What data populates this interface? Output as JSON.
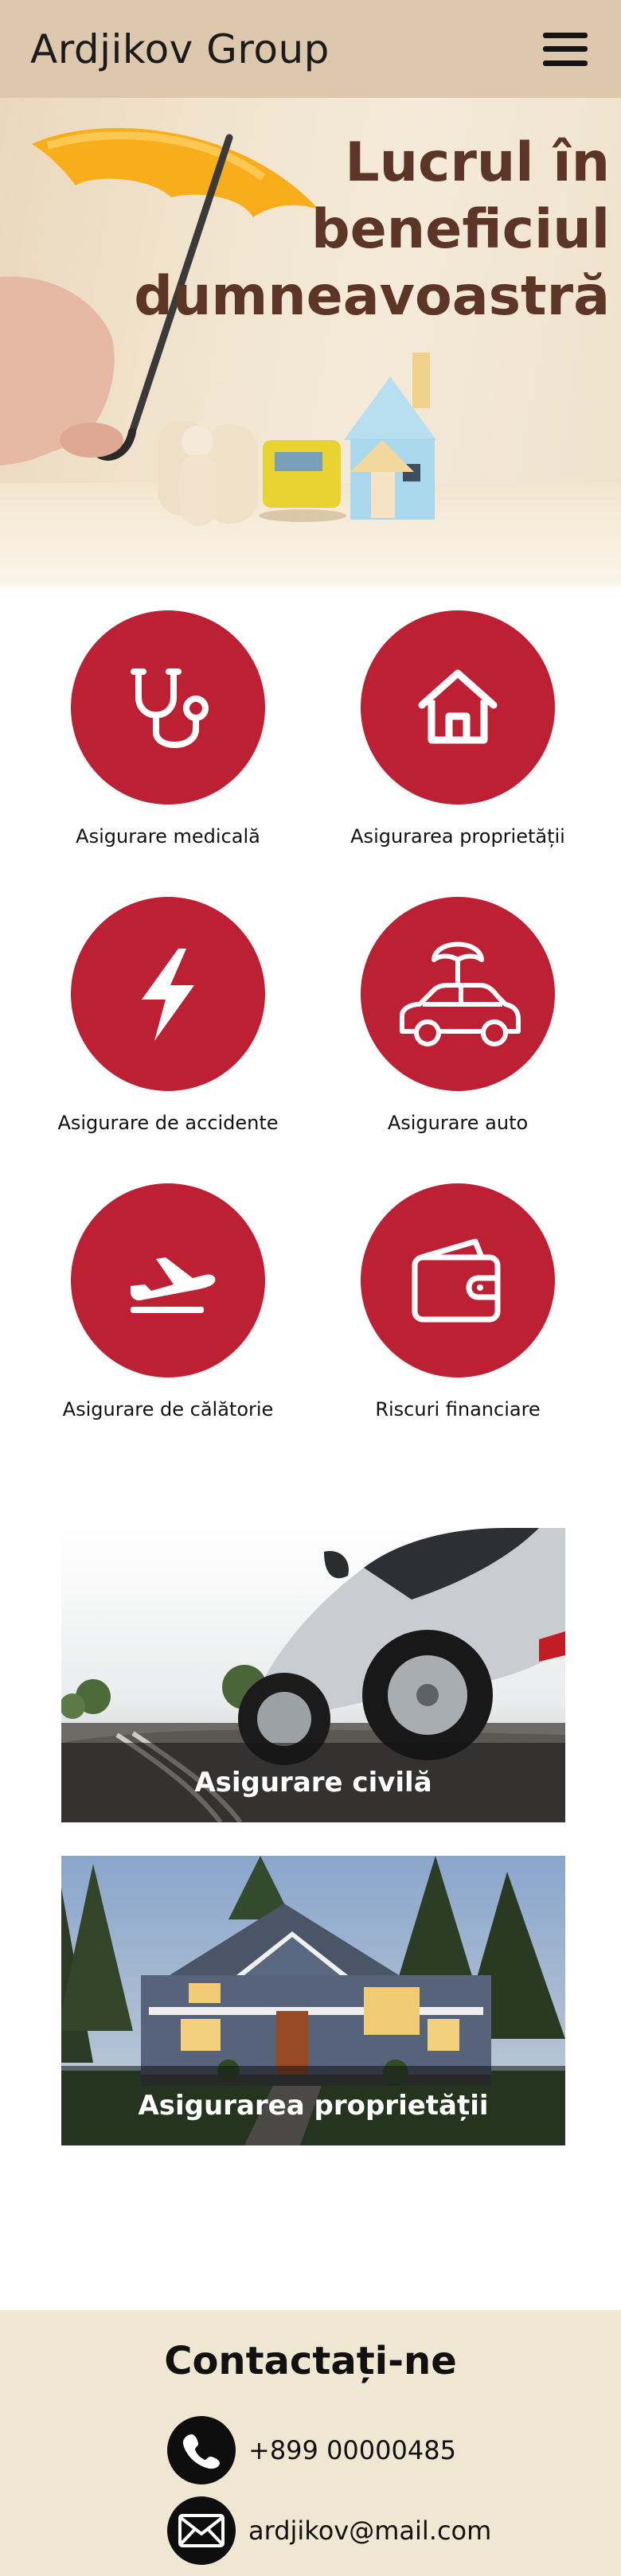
{
  "header": {
    "brand": "Ardjikov Group",
    "menu_icon": "hamburger-menu-icon"
  },
  "hero": {
    "title_lines": [
      "Lucrul în",
      "beneficiul",
      "dumneavoastră"
    ]
  },
  "services": [
    {
      "label": "Asigurare medicală",
      "icon": "stethoscope-icon"
    },
    {
      "label": "Asigurarea proprietății",
      "icon": "house-icon"
    },
    {
      "label": "Asigurare de accidente",
      "icon": "lightning-icon"
    },
    {
      "label": "Asigurare auto",
      "icon": "car-umbrella-icon"
    },
    {
      "label": "Asigurare de călătorie",
      "icon": "airplane-icon"
    },
    {
      "label": "Riscuri financiare",
      "icon": "wallet-icon"
    }
  ],
  "cards": [
    {
      "caption": "Asigurare civilă"
    },
    {
      "caption": "Asigurarea proprietății"
    }
  ],
  "contact": {
    "title": "Contactați-ne",
    "phone": "+899 00000485",
    "email": "ardjikov@mail.com"
  },
  "colors": {
    "header_bg": "#dec8ad",
    "accent_red": "#bd1f33",
    "hero_title": "#5d3526",
    "contact_bg": "#f0e7d3"
  }
}
